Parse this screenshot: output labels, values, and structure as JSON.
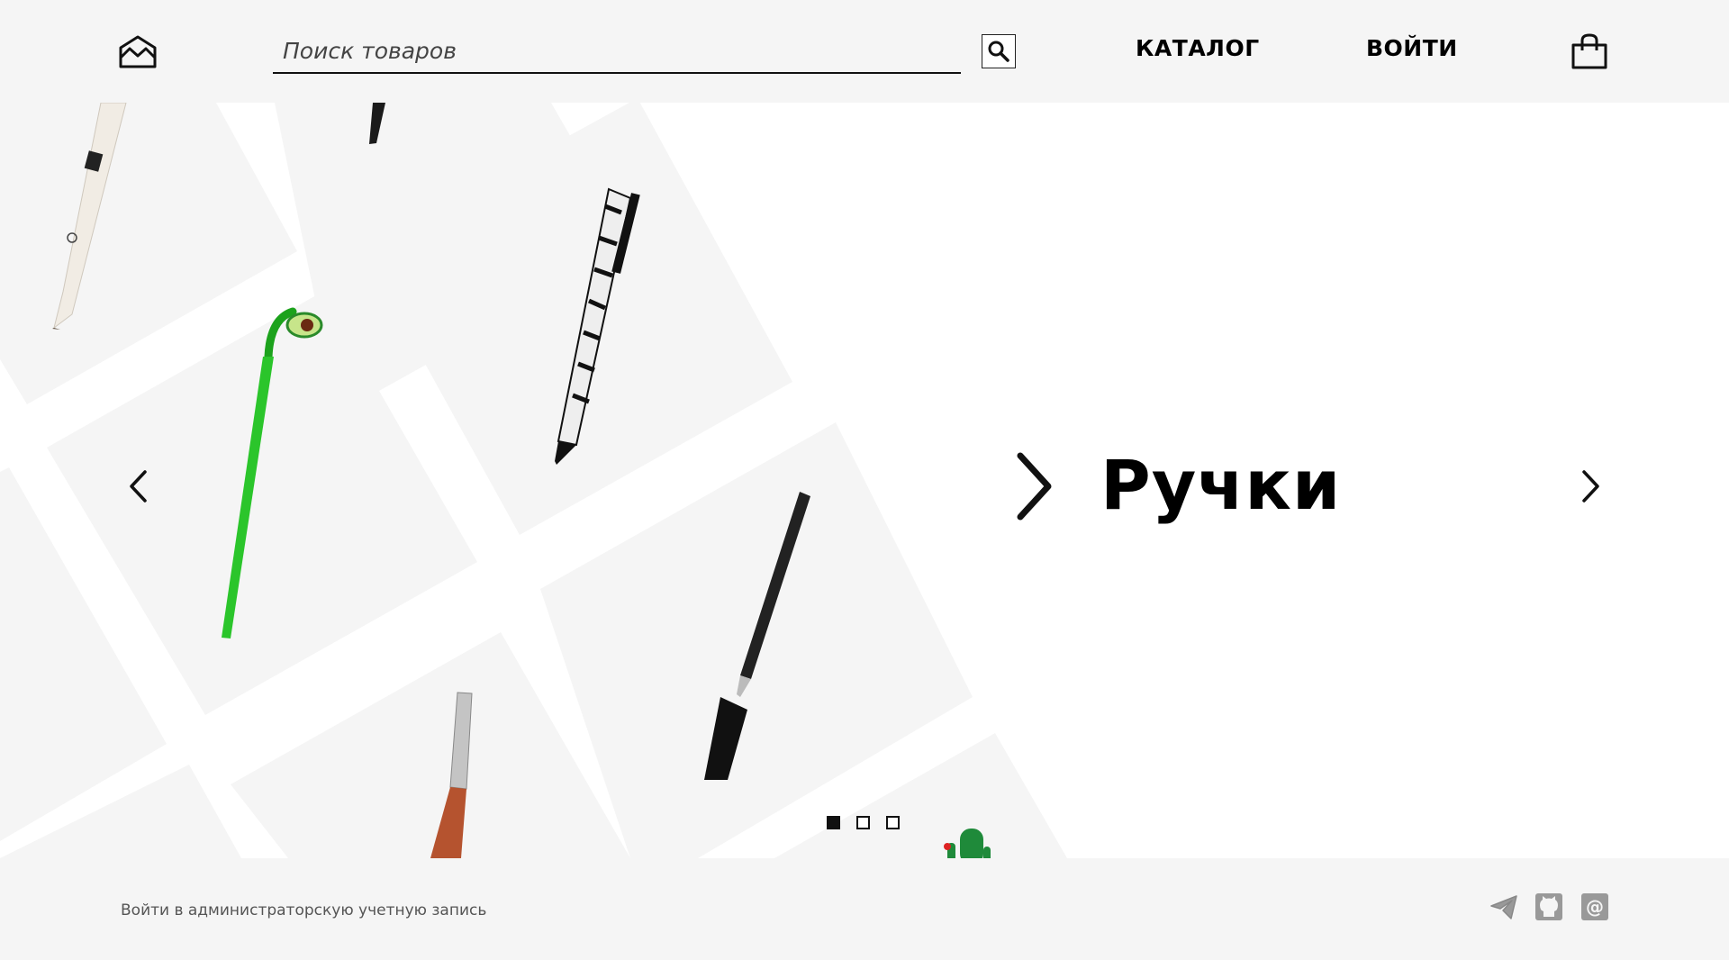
{
  "header": {
    "logo_icon": "crown-envelope-icon",
    "search": {
      "placeholder": "Поиск товаров",
      "value": "",
      "button_icon": "search-icon"
    },
    "nav": {
      "catalog": "КАТАЛОГ",
      "login": "ВОЙТИ"
    },
    "cart_icon": "shopping-bag-icon"
  },
  "hero": {
    "title": "Ручки",
    "prev_icon": "chevron-left-icon",
    "next_icon": "chevron-right-icon",
    "pointer_icon": "chevron-right-large-icon",
    "slides": {
      "count": 3,
      "active": 1
    }
  },
  "footer": {
    "admin_link": "Войти в администраторскую учетную запись",
    "social": [
      "telegram-icon",
      "github-icon",
      "email-icon"
    ]
  },
  "colors": {
    "header_bg": "#f5f5f5",
    "footer_bg": "#f5f5f5",
    "accent": "#000000"
  }
}
